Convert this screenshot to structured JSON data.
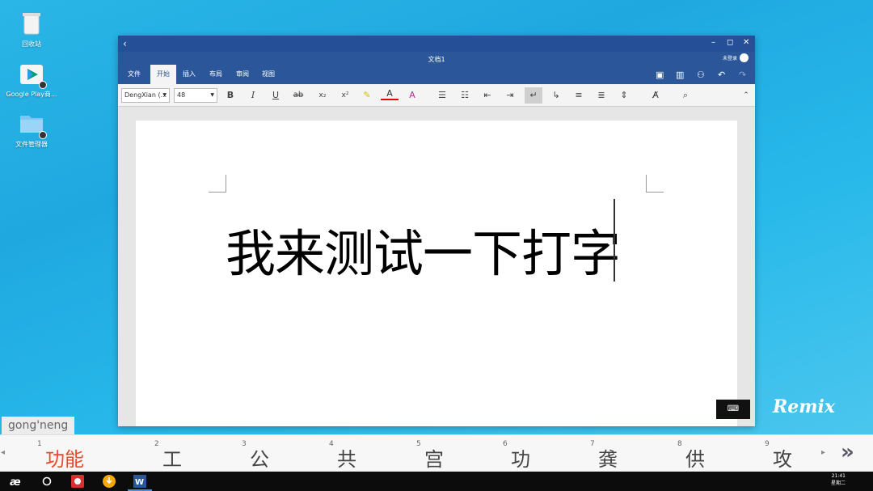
{
  "desktop": {
    "icons": [
      {
        "label": "回收站"
      },
      {
        "label": "Google Play商..."
      },
      {
        "label": "文件管理器"
      }
    ]
  },
  "window": {
    "doc_title": "文档1",
    "user_label": "未登录",
    "tabs": [
      "文件",
      "开始",
      "插入",
      "布局",
      "审阅",
      "视图"
    ],
    "active_tab": "开始",
    "font_name": "DengXian (...",
    "font_size": "48",
    "document_text": "我来测试一下打字"
  },
  "ime": {
    "pinyin": "gong'neng",
    "candidates": [
      {
        "num": "1",
        "text": "功能"
      },
      {
        "num": "2",
        "text": "工"
      },
      {
        "num": "3",
        "text": "公"
      },
      {
        "num": "4",
        "text": "共"
      },
      {
        "num": "5",
        "text": "宫"
      },
      {
        "num": "6",
        "text": "功"
      },
      {
        "num": "7",
        "text": "龚"
      },
      {
        "num": "8",
        "text": "供"
      },
      {
        "num": "9",
        "text": "攻"
      }
    ],
    "more": "»"
  },
  "brand": {
    "remix": "Remix"
  },
  "taskbar": {
    "time": "21:41",
    "day": "星期二"
  },
  "colors": {
    "ribbon": "#2b579a",
    "titlebar": "#254f96",
    "accent_candidate": "#e84a2a"
  }
}
